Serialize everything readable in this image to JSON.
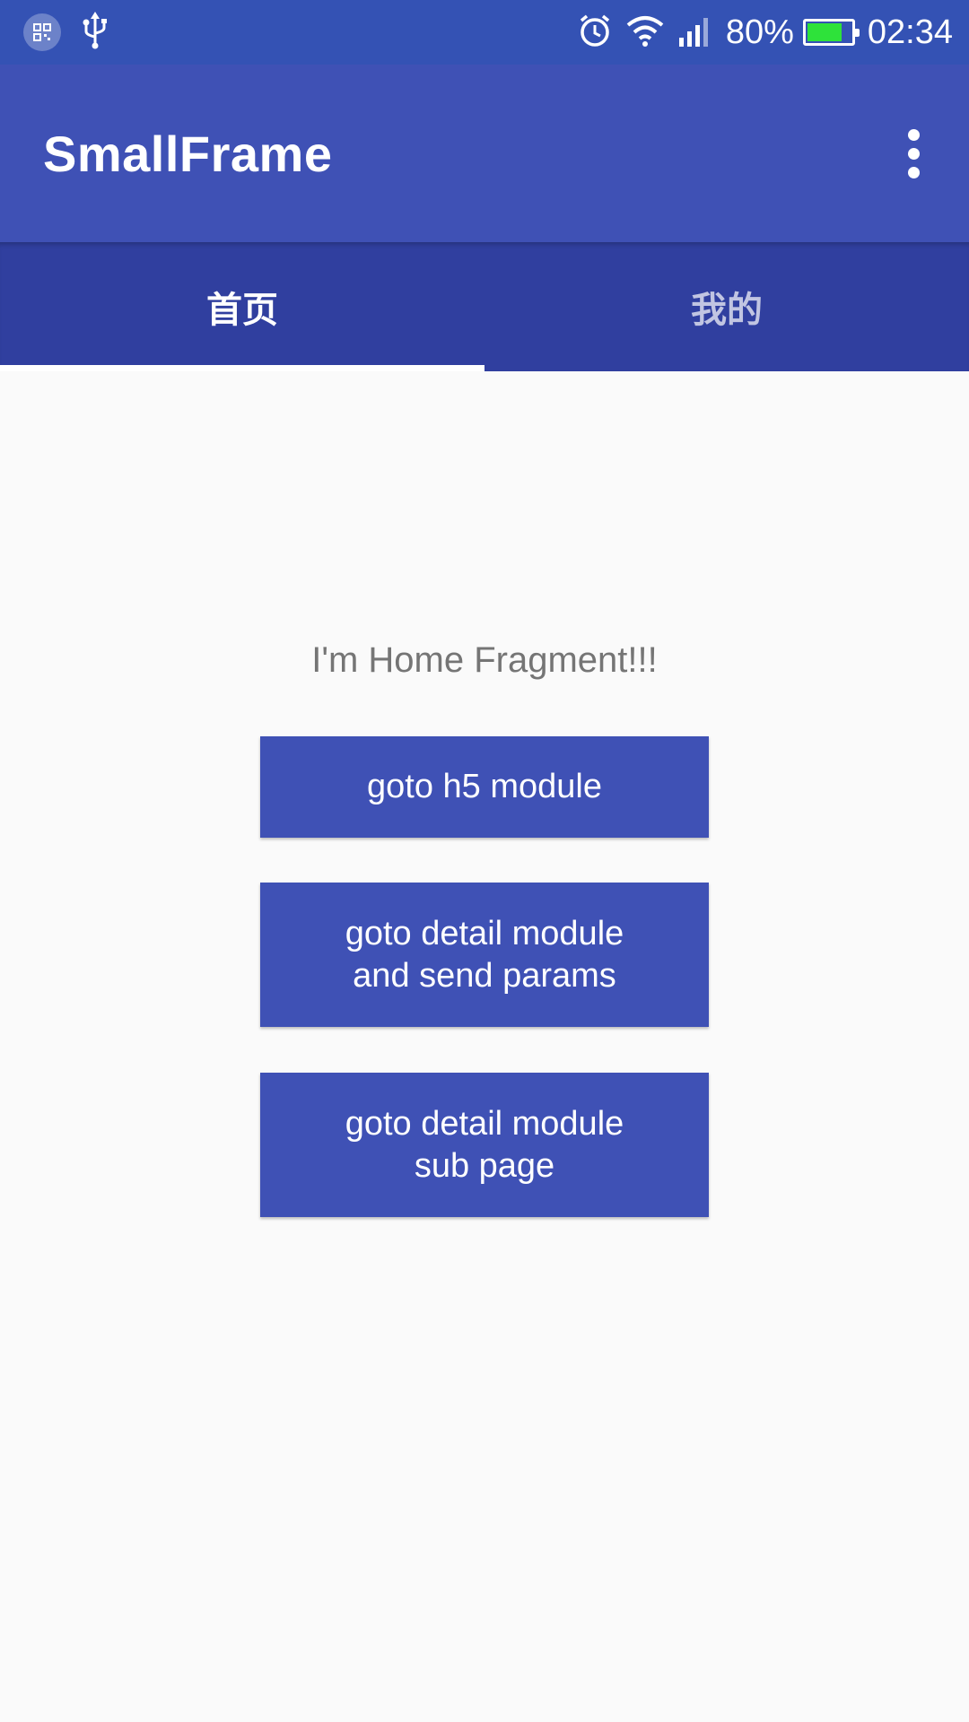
{
  "status_bar": {
    "battery_percent": "80%",
    "battery_level": 0.8,
    "time": "02:34",
    "icons": [
      "notification-icon",
      "usb-icon",
      "alarm-icon",
      "wifi-icon",
      "signal-icon",
      "battery-icon"
    ],
    "battery_color": "#2EE23A"
  },
  "toolbar": {
    "title": "SmallFrame",
    "menu_icon": "more-vert-icon",
    "color": "#3F51B5"
  },
  "tabs": [
    {
      "label": "首页",
      "selected": true
    },
    {
      "label": "我的",
      "selected": false
    }
  ],
  "content": {
    "label": "I'm Home Fragment!!!",
    "buttons": [
      {
        "label": "goto h5 module"
      },
      {
        "label": "goto detail module\nand send params"
      },
      {
        "label": "goto detail module\nsub page"
      }
    ]
  },
  "colors": {
    "primary": "#3F51B5",
    "primary_dark": "#303F9F",
    "status_bar": "#3452B4",
    "background": "#FAFAFA"
  }
}
